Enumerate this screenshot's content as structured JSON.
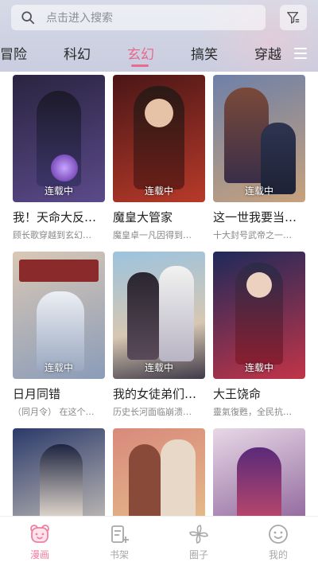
{
  "search": {
    "placeholder": "点击进入搜索"
  },
  "tabs": [
    {
      "label": "冒险"
    },
    {
      "label": "科幻"
    },
    {
      "label": "玄幻"
    },
    {
      "label": "搞笑"
    },
    {
      "label": "穿越"
    }
  ],
  "active_tab": "玄幻",
  "comics": [
    {
      "title": "我！天命大反…",
      "desc": "顾长歌穿越到玄幻…",
      "status": "连载中",
      "palette": [
        "#2a2440",
        "#5b4a8a"
      ]
    },
    {
      "title": "魔皇大管家",
      "desc": "魔皇卓一凡因得到…",
      "status": "连载中",
      "palette": [
        "#4a1616",
        "#b83a2a"
      ]
    },
    {
      "title": "这一世我要当…",
      "desc": "十大封号武帝之一…",
      "status": "连载中",
      "palette": [
        "#6e80a8",
        "#c7a27c"
      ]
    },
    {
      "title": "日月同错",
      "desc": "（同月令）  在这个…",
      "status": "连载中",
      "palette": [
        "#c9b8a8",
        "#6a7e9c"
      ]
    },
    {
      "title": "我的女徒弟们…",
      "desc": "历史长河面临崩溃…",
      "status": "连载中",
      "palette": [
        "#9cc3de",
        "#3e3a48"
      ]
    },
    {
      "title": "大王饶命",
      "desc": "靈氣復甦，全民抗…",
      "status": "连载中",
      "palette": [
        "#1e2a5a",
        "#c23448"
      ]
    },
    {
      "title": "",
      "desc": "",
      "status": "",
      "palette": [
        "#2b3a6a",
        "#e3d9c8"
      ]
    },
    {
      "title": "",
      "desc": "",
      "status": "",
      "palette": [
        "#d88a7c",
        "#e8c88c"
      ]
    },
    {
      "title": "",
      "desc": "",
      "status": "",
      "palette": [
        "#e7d8e6",
        "#7a4a8a"
      ]
    }
  ],
  "bottom_nav": [
    {
      "label": "漫画",
      "icon": "bear-icon",
      "active": true
    },
    {
      "label": "书架",
      "icon": "bookshelf-icon",
      "active": false
    },
    {
      "label": "圈子",
      "icon": "pinwheel-icon",
      "active": false
    },
    {
      "label": "我的",
      "icon": "smiley-icon",
      "active": false
    }
  ],
  "colors": {
    "accent": "#e86a8c",
    "nav_active": "#ef7ea0",
    "nav_inactive": "#a8a8a8"
  }
}
